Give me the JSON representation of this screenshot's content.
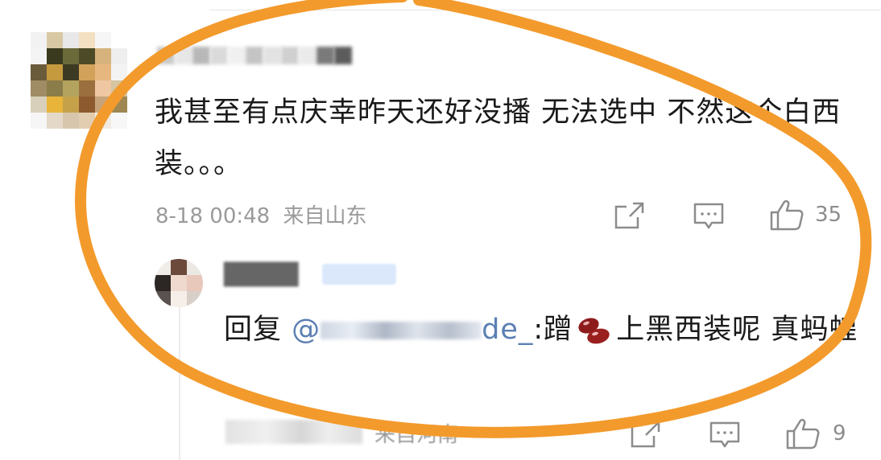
{
  "comment": {
    "text": "我甚至有点庆幸昨天还好没播 无法选中 不然这个白西装。。。",
    "date": "8-18 00:48",
    "region": "来自山东",
    "like_count": "35"
  },
  "reply": {
    "prefix": "回复 ",
    "mention_start": "@",
    "mention_end": "de_",
    "colon": ":",
    "text_before_emoji": "蹭",
    "text_after_emoji": "上黑西装呢 真蚂蝗",
    "region": "来自河南",
    "like_count": "9"
  },
  "icons": {
    "share": "share-icon",
    "comment": "comment-icon",
    "like": "thumbs-up-icon",
    "emoji": "red-beans-emoji"
  },
  "colors": {
    "circle": "#f39a2c",
    "mention": "#5b7fb3",
    "meta": "#9a9a9a"
  }
}
